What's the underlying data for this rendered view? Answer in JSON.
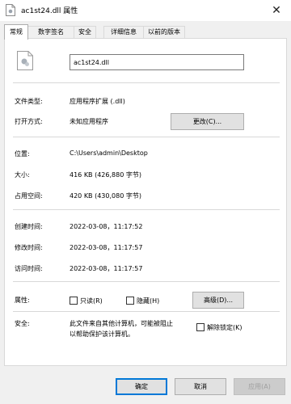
{
  "window": {
    "title": "ac1st24.dll 属性",
    "close_glyph": "✕"
  },
  "tabs": [
    "常规",
    "数字签名",
    "安全",
    "详细信息",
    "以前的版本"
  ],
  "general": {
    "filename": "ac1st24.dll",
    "rows": {
      "file_type": {
        "label": "文件类型:",
        "value": "应用程序扩展 (.dll)"
      },
      "open_with": {
        "label": "打开方式:",
        "value": "未知应用程序",
        "button": "更改(C)..."
      },
      "location": {
        "label": "位置:",
        "value": "C:\\Users\\admin\\Desktop"
      },
      "size": {
        "label": "大小:",
        "value": "416 KB (426,880 字节)"
      },
      "size_on_disk": {
        "label": "占用空间:",
        "value": "420 KB (430,080 字节)"
      },
      "created": {
        "label": "创建时间:",
        "value": "2022-03-08，11:17:52"
      },
      "modified": {
        "label": "修改时间:",
        "value": "2022-03-08，11:17:57"
      },
      "accessed": {
        "label": "访问时间:",
        "value": "2022-03-08，11:17:57"
      },
      "attributes": {
        "label": "属性:",
        "readonly": "只读(R)",
        "hidden": "隐藏(H)",
        "advanced_button": "高级(D)..."
      },
      "security": {
        "label": "安全:",
        "line1": "此文件来自其他计算机，可能被阻止",
        "line2": "以帮助保护该计算机。",
        "unblock": "解除锁定(K)"
      }
    }
  },
  "footer": {
    "ok": "确定",
    "cancel": "取消",
    "apply": "应用(A)"
  }
}
